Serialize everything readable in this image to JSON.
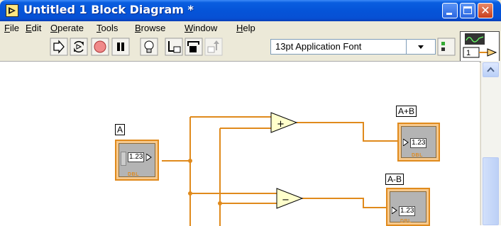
{
  "window": {
    "title": "Untitled 1 Block Diagram *"
  },
  "menu": [
    {
      "key": "File",
      "rest": "ile",
      "underline": "F"
    },
    {
      "key": "Edit",
      "rest": "dit",
      "underline": "E"
    },
    {
      "key": "Operate",
      "rest": "perate",
      "underline": "O"
    },
    {
      "key": "Tools",
      "rest": "ools",
      "underline": "T"
    },
    {
      "key": "Browse",
      "rest": "rowse",
      "underline": "B"
    },
    {
      "key": "Window",
      "rest": "indow",
      "underline": "W"
    },
    {
      "key": "Help",
      "rest": "elp",
      "underline": "H"
    }
  ],
  "toolbar": {
    "font": "13pt Application Font",
    "buttons": [
      "run-icon",
      "run-continuously-icon",
      "abort-icon",
      "pause-icon",
      "highlight-execution-icon",
      "step-into-icon",
      "step-over-icon",
      "step-out-icon"
    ]
  },
  "vi_icon": {
    "label": "1"
  },
  "diagram": {
    "control_a": {
      "label": "A",
      "value": "1.23",
      "type": "DBL"
    },
    "indicator_sum": {
      "label": "A+B",
      "value": "1.23",
      "type": "DBL"
    },
    "indicator_diff": {
      "label": "A-B",
      "value": "1.23",
      "type": "DBL"
    },
    "add_node": {
      "symbol": "+"
    },
    "subtract_node": {
      "symbol": "−"
    }
  },
  "colors": {
    "wire": "#e08a1c",
    "titlebar": "#0554d8"
  }
}
